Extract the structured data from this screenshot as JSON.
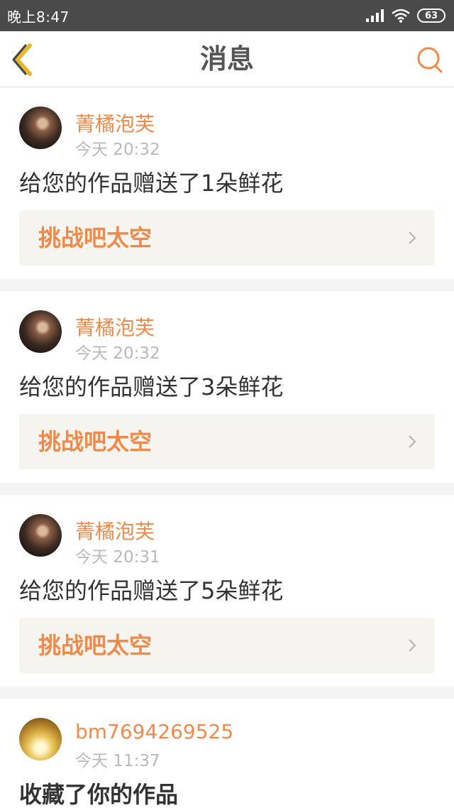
{
  "status_bar": {
    "time": "晚上8:47",
    "battery": "63",
    "icons": [
      "signal-icon",
      "wifi-icon",
      "battery-icon"
    ]
  },
  "header": {
    "title": "消息",
    "icons": [
      "back-arrow-icon",
      "search-icon"
    ]
  },
  "colors": {
    "accent": "#f08a4b",
    "text": "#333333",
    "muted": "#b9b9b9",
    "link_bg": "#f5f4ee"
  },
  "messages": [
    {
      "user": "菁橘泡芙",
      "time": "今天 20:32",
      "text": "给您的作品赠送了1朵鲜花",
      "work": "挑战吧太空"
    },
    {
      "user": "菁橘泡芙",
      "time": "今天 20:32",
      "text": "给您的作品赠送了3朵鲜花",
      "work": "挑战吧太空"
    },
    {
      "user": "菁橘泡芙",
      "time": "今天 20:31",
      "text": "给您的作品赠送了5朵鲜花",
      "work": "挑战吧太空"
    },
    {
      "user": "bm7694269525",
      "time": "今天 11:37",
      "text": "收藏了你的作品"
    }
  ]
}
